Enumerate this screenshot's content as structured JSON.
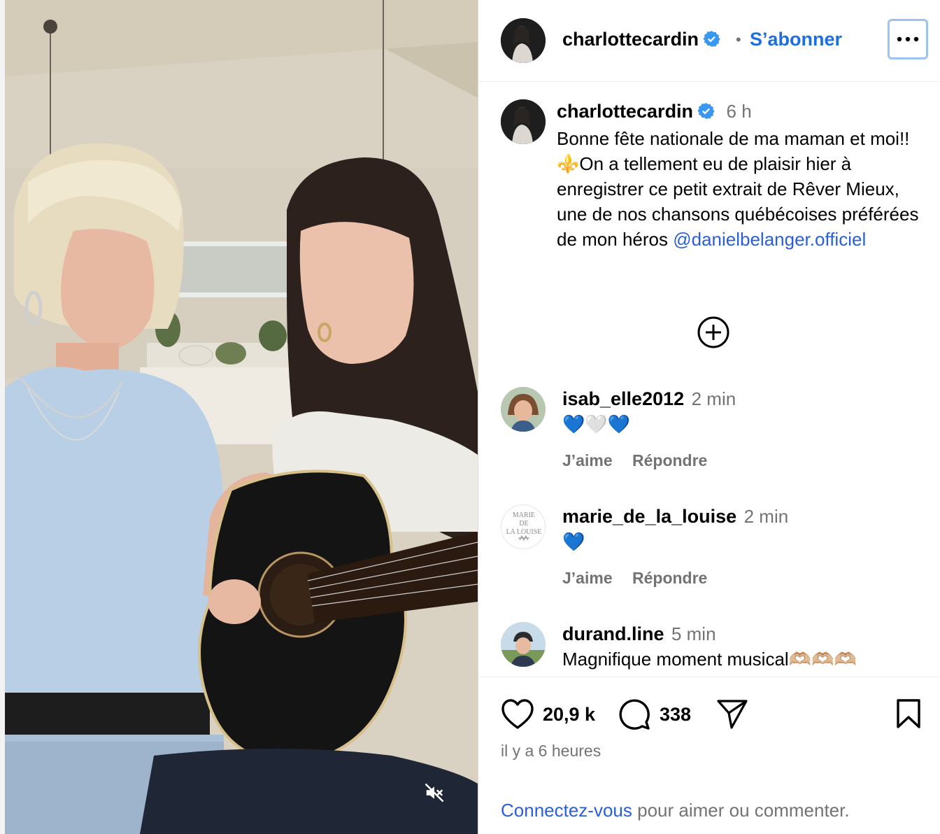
{
  "post": {
    "author": "charlottecardin",
    "follow_label": "S’abonner",
    "caption_time": "6 h",
    "caption_text": "Bonne fête nationale de ma maman et moi!!⚜️On a tellement eu de plaisir hier à enregistrer ce petit extrait de Rêver Mieux, une de nos chansons québécoises préférées de mon héros",
    "caption_mention": "@danielbelanger.officiel"
  },
  "comments": [
    {
      "user": "isab_elle2012",
      "time": "2 min",
      "text": "💙🤍💙",
      "like_label": "J’aime",
      "reply_label": "Répondre"
    },
    {
      "user": "marie_de_la_louise",
      "time": "2 min",
      "text": "💙",
      "like_label": "J’aime",
      "reply_label": "Répondre"
    },
    {
      "user": "durand.line",
      "time": "5 min",
      "text": "Magnifique moment musical🫶🏼🫶🏼🫶🏼"
    }
  ],
  "avatar_text": {
    "marie": [
      "MARIE",
      "DE",
      "LA LOUISE"
    ]
  },
  "stats": {
    "likes": "20,9 k",
    "comments": "338"
  },
  "posted_ago": "il y a 6 heures",
  "login_prompt": {
    "link": "Connectez-vous",
    "rest": " pour aimer ou commenter."
  },
  "colors": {
    "link": "#2b5fd9",
    "verified": "#3897f0",
    "secondary_text": "#737373"
  },
  "icons": [
    "verified-badge-icon",
    "more-options-icon",
    "add-circle-icon",
    "heart-icon",
    "comment-icon",
    "share-icon",
    "bookmark-icon",
    "muted-speaker-icon"
  ]
}
